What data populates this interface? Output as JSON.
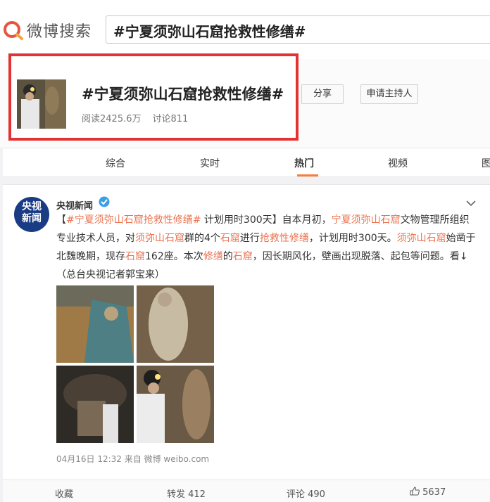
{
  "header": {
    "logo_text": "微博搜索",
    "search_value": "#宁夏须弥山石窟抢救性修缮#"
  },
  "topic": {
    "title": "#宁夏须弥山石窟抢救性修缮#",
    "reads": "阅读2425.6万",
    "discussions": "讨论811",
    "share_label": "分享",
    "host_label": "申请主持人"
  },
  "tabs": [
    "综合",
    "实时",
    "热门",
    "视频",
    "图"
  ],
  "active_tab": "热门",
  "post": {
    "avatar_text_line1": "央视",
    "avatar_text_line2": "新闻",
    "author": "央视新闻",
    "segments": [
      {
        "text": "【",
        "hl": false
      },
      {
        "text": "#宁夏须弥山石窟抢救性修缮#",
        "hl": true
      },
      {
        "text": " 计划用时300天】自本月初，",
        "hl": false
      },
      {
        "text": "宁夏须弥山石窟",
        "hl": true
      },
      {
        "text": "文物管理所组织专业技术人员，对",
        "hl": false
      },
      {
        "text": "须弥山石窟",
        "hl": true
      },
      {
        "text": "群的4个",
        "hl": false
      },
      {
        "text": "石窟",
        "hl": true
      },
      {
        "text": "进行",
        "hl": false
      },
      {
        "text": "抢救性修缮",
        "hl": true
      },
      {
        "text": "，计划用时300天。",
        "hl": false
      },
      {
        "text": "须弥山石窟",
        "hl": true
      },
      {
        "text": "始凿于北魏晚期，现存",
        "hl": false
      },
      {
        "text": "石窟",
        "hl": true
      },
      {
        "text": "162座。本次",
        "hl": false
      },
      {
        "text": "修缮",
        "hl": true
      },
      {
        "text": "的",
        "hl": false
      },
      {
        "text": "石窟",
        "hl": true
      },
      {
        "text": "，因长期风化，壁画出现脱落、起包等问题。看↓（总台央视记者郭宝来）",
        "hl": false
      }
    ],
    "timestamp": "04月16日 12:32",
    "source": "来自 微博 weibo.com"
  },
  "actions": {
    "favorite": "收藏",
    "repost": "转发 412",
    "comment": "评论 490",
    "like": "5637"
  },
  "colors": {
    "highlight": "#eb7350",
    "red_frame": "#e23232",
    "tab_underline": "#fa7d3c",
    "verify_badge": "#3a9fe6",
    "logo_accent": "#e8543f"
  }
}
